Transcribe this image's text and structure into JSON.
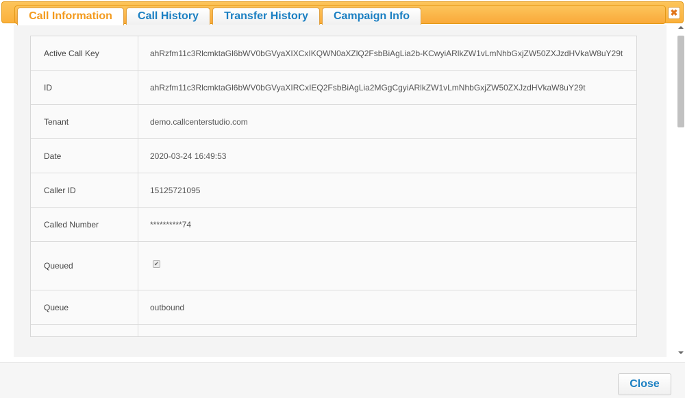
{
  "dialog": {
    "close_glyph": "✖"
  },
  "tabs": [
    {
      "label": "Call Information",
      "active": true
    },
    {
      "label": "Call History",
      "active": false
    },
    {
      "label": "Transfer History",
      "active": false
    },
    {
      "label": "Campaign Info",
      "active": false
    }
  ],
  "rows": [
    {
      "label": "Active Call Key",
      "value": "ahRzfm11c3RlcmktaGl6bWV0bGVyaXIXCxIKQWN0aXZlQ2FsbBiAgLia2b-KCwyiARlkZW1vLmNhbGxjZW50ZXJzdHVkaW8uY29t"
    },
    {
      "label": "ID",
      "value": "ahRzfm11c3RlcmktaGl6bWV0bGVyaXIRCxIEQ2FsbBiAgLia2MGgCgyiARlkZW1vLmNhbGxjZW50ZXJzdHVkaW8uY29t"
    },
    {
      "label": "Tenant",
      "value": "demo.callcenterstudio.com"
    },
    {
      "label": "Date",
      "value": "2020-03-24 16:49:53"
    },
    {
      "label": "Caller ID",
      "value": "15125721095"
    },
    {
      "label": "Called Number",
      "value": "**********74"
    },
    {
      "label": "Queued",
      "value": "",
      "checkbox": true,
      "check_glyph": "✔"
    },
    {
      "label": "Queue",
      "value": "outbound"
    },
    {
      "label": "",
      "value": ""
    }
  ],
  "footer": {
    "close_label": "Close"
  },
  "colors": {
    "accent": "#fbb03b",
    "link_blue": "#1a7fc2",
    "active_tab": "#f39a1c"
  }
}
